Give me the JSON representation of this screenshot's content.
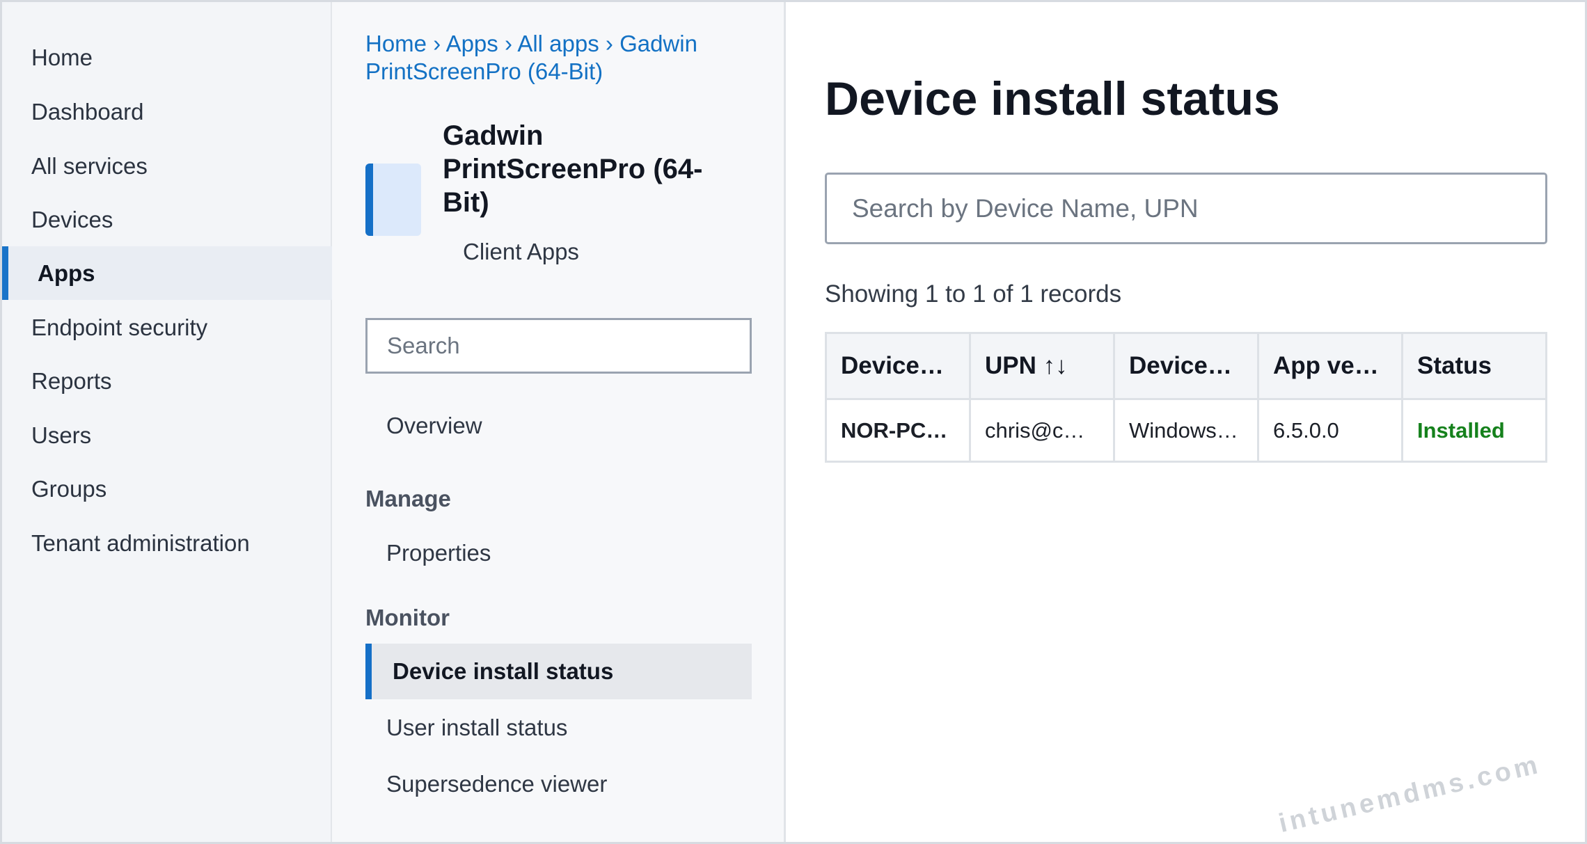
{
  "nav": {
    "items": [
      {
        "label": "Home"
      },
      {
        "label": "Dashboard"
      },
      {
        "label": "All services"
      },
      {
        "label": "Devices"
      },
      {
        "label": "Apps",
        "active": true
      },
      {
        "label": "Endpoint security"
      },
      {
        "label": "Reports"
      },
      {
        "label": "Users"
      },
      {
        "label": "Groups"
      },
      {
        "label": "Tenant administration"
      }
    ]
  },
  "breadcrumb": {
    "items": [
      "Home",
      "Apps",
      "All apps",
      "Gadwin PrintScreenPro (64-Bit)"
    ],
    "separator": "›"
  },
  "app": {
    "title": "Gadwin PrintScreenPro (64-Bit)",
    "subtitle": "Client Apps"
  },
  "blade": {
    "search_placeholder": "Search",
    "overview_label": "Overview",
    "manage_heading": "Manage",
    "properties_label": "Properties",
    "monitor_heading": "Monitor",
    "monitor_items": [
      {
        "label": "Device install status",
        "active": true
      },
      {
        "label": "User install status"
      },
      {
        "label": "Supersedence viewer"
      }
    ]
  },
  "main": {
    "title": "Device install status",
    "search_placeholder": "Search by Device Name, UPN",
    "records_text": "Showing 1 to 1 of 1 records",
    "table": {
      "columns": [
        "Device…",
        "UPN ↑↓",
        "Device…",
        "App ve…",
        "Status"
      ],
      "rows": [
        [
          "NOR-PC…",
          "chris@c…",
          "Windows…",
          "6.5.0.0",
          "Installed"
        ]
      ]
    }
  },
  "watermark": "intunemdms.com",
  "colors": {
    "accent": "#1570c7",
    "link": "#1371c4",
    "status_installed": "#15811c"
  }
}
